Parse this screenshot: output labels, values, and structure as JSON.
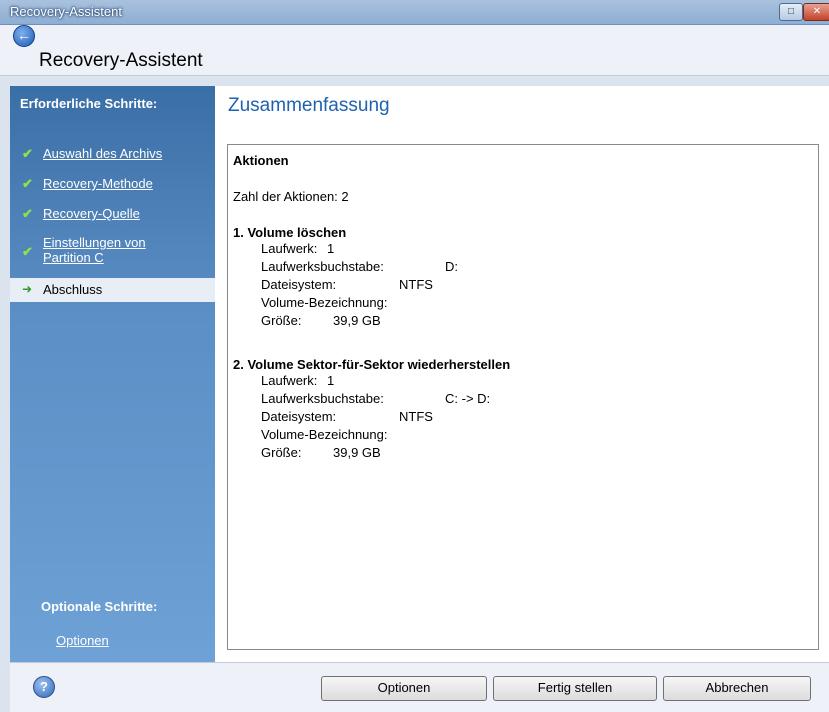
{
  "window": {
    "title_bar": "Recovery-Assistent",
    "heading": "Recovery-Assistent",
    "minimize_glyph": "□",
    "close_glyph": "✕"
  },
  "sidebar": {
    "required_heading": "Erforderliche Schritte:",
    "items": [
      {
        "label": "Auswahl des Archivs",
        "state": "done"
      },
      {
        "label": "Recovery-Methode",
        "state": "done"
      },
      {
        "label": "Recovery-Quelle",
        "state": "done"
      },
      {
        "label": "Einstellungen von Partition C",
        "state": "done"
      },
      {
        "label": "Abschluss",
        "state": "current"
      }
    ],
    "optional_heading": "Optionale Schritte:",
    "optional_link": "Optionen",
    "check_glyph": "✔",
    "arrow_glyph": "➜"
  },
  "main": {
    "title": "Zusammenfassung",
    "summary": {
      "heading": "Aktionen",
      "count_line": "Zahl der Aktionen: 2",
      "action1": {
        "title": "1. Volume löschen",
        "drive_label": "Laufwerk:",
        "drive_value": "1",
        "letter_label": "Laufwerksbuchstabe:",
        "letter_value": "D:",
        "fs_label": "Dateisystem:",
        "fs_value": "NTFS",
        "vol_label": "Volume-Bezeichnung:",
        "size_label": "Größe:",
        "size_value": "39,9 GB"
      },
      "action2": {
        "title": "2. Volume Sektor-für-Sektor wiederherstellen",
        "drive_label": "Laufwerk:",
        "drive_value": "1",
        "letter_label": "Laufwerksbuchstabe:",
        "letter_value": "C: -> D:",
        "fs_label": "Dateisystem:",
        "fs_value": "NTFS",
        "vol_label": "Volume-Bezeichnung:",
        "size_label": "Größe:",
        "size_value": "39,9 GB"
      }
    }
  },
  "footer": {
    "help_glyph": "?",
    "buttons": {
      "options": "Optionen",
      "finish": "Fertig stellen",
      "cancel": "Abbrechen"
    }
  },
  "icons": {
    "back": "back-arrow-icon",
    "help": "help-icon",
    "check": "checkmark-icon",
    "current": "current-step-arrow-icon"
  },
  "colors": {
    "accent_title": "#1e62b0",
    "sidebar_blue": "#5b8fc5",
    "check_green": "#8be24a"
  }
}
